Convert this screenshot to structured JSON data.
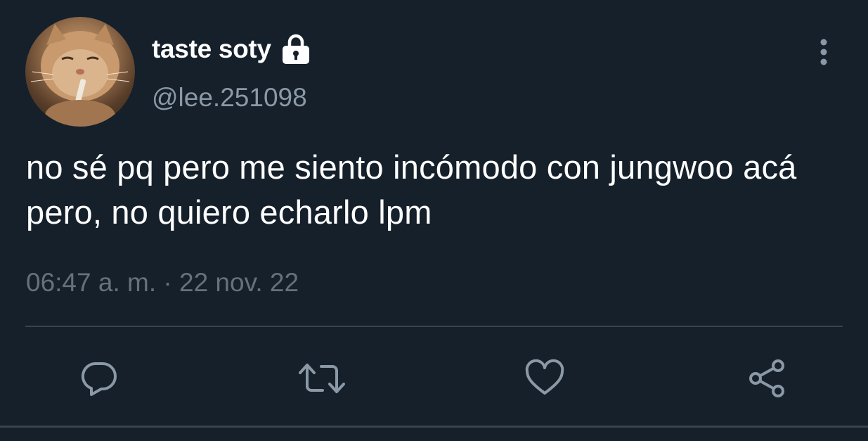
{
  "tweet": {
    "display_name": "taste soty",
    "handle": "@lee.251098",
    "text": "no sé pq pero me siento incómodo con jungwoo acá pero, no quiero echarlo lpm",
    "time": "06:47 a. m.",
    "separator": "·",
    "date": "22 nov. 22",
    "protected": true
  },
  "icons": {
    "avatar": "cat-avatar",
    "lock": "lock-icon",
    "more": "more-vertical-icon",
    "reply": "reply-icon",
    "retweet": "retweet-icon",
    "like": "heart-icon",
    "share": "share-icon"
  },
  "colors": {
    "background": "#15202b",
    "text": "#ffffff",
    "secondary": "#8b98a5",
    "muted": "#67717b",
    "divider": "#38444d",
    "icon": "#8b98a5"
  }
}
